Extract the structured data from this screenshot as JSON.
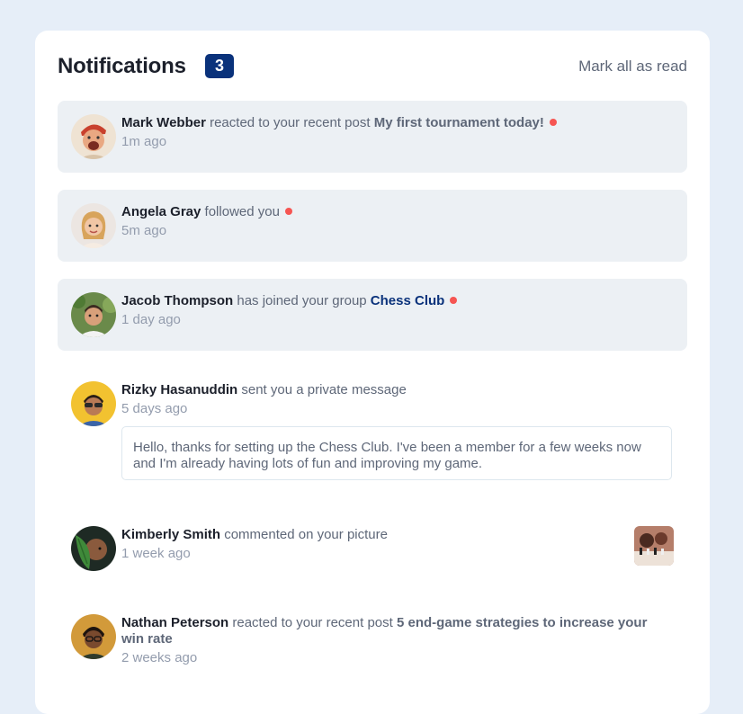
{
  "header": {
    "title": "Notifications",
    "count": "3",
    "mark_all": "Mark all as read"
  },
  "notifications": [
    {
      "name": "Mark Webber",
      "action": "reacted to your recent post",
      "target": "My first tournament today!",
      "time": "1m ago",
      "unread": true
    },
    {
      "name": "Angela Gray",
      "action": "followed you",
      "time": "5m ago",
      "unread": true
    },
    {
      "name": "Jacob Thompson",
      "action": "has joined your group",
      "target": "Chess Club",
      "time": "1 day ago",
      "unread": true
    },
    {
      "name": "Rizky Hasanuddin",
      "action": "sent you a private message",
      "time": "5 days ago",
      "unread": false,
      "message": "Hello, thanks for setting up the Chess Club. I've been a member for a few weeks now and I'm already having lots of fun and improving my game."
    },
    {
      "name": "Kimberly Smith",
      "action": "commented on your picture",
      "time": "1 week ago",
      "unread": false
    },
    {
      "name": "Nathan Peterson",
      "action": "reacted to your recent post",
      "target": "5 end-game strategies to increase your win rate",
      "time": "2 weeks ago",
      "unread": false
    }
  ],
  "colors": {
    "background": "#e6eef8",
    "card": "#ffffff",
    "unread_bg": "#ecf0f4",
    "badge": "#0a327b",
    "dot": "#f65552",
    "text_dark": "#1c202b",
    "text_muted": "#5e6778",
    "text_light": "#939cad"
  }
}
